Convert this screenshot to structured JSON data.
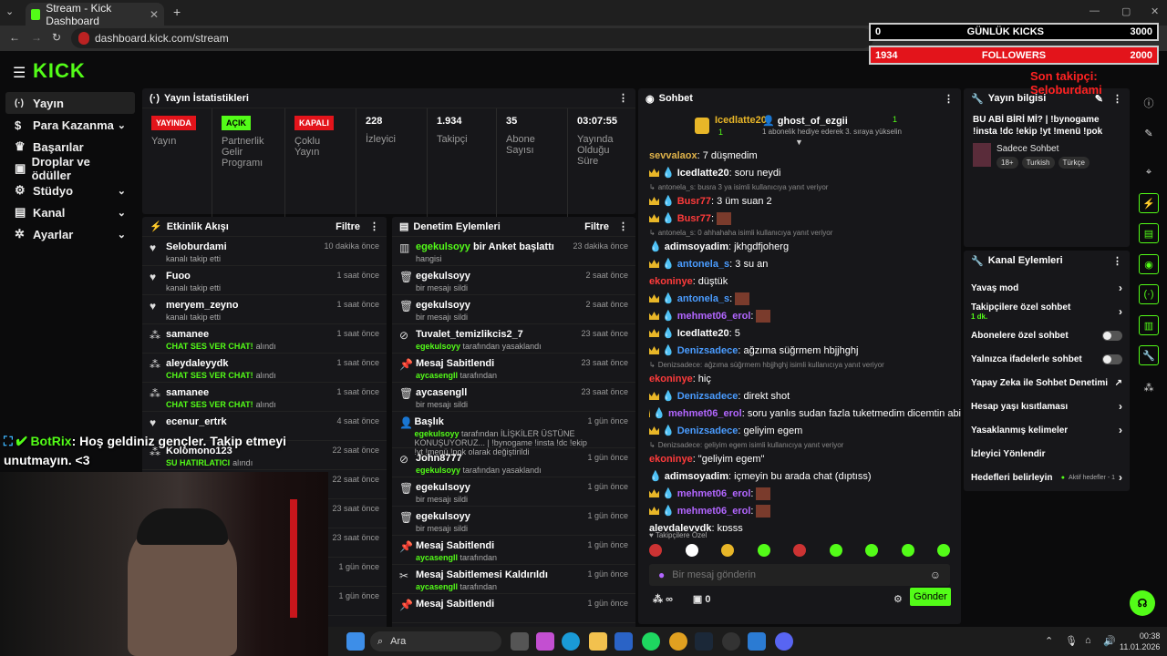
{
  "browser": {
    "tab_title": "Stream - Kick Dashboard",
    "url": "dashboard.kick.com/stream"
  },
  "overlay": {
    "kicks_left": "0",
    "kicks_label": "GÜNLÜK KICKS",
    "kicks_right": "3000",
    "followers_left": "1934",
    "followers_label": "FOLLOWERS",
    "followers_right": "2000",
    "last_follower": "Son takipçi: Seloburdami"
  },
  "logo": "KICK",
  "sidebar": {
    "items": [
      {
        "label": "Yayın"
      },
      {
        "label": "Para Kazanma"
      },
      {
        "label": "Başarılar"
      },
      {
        "label": "Droplar ve ödüller"
      },
      {
        "label": "Stüdyo"
      },
      {
        "label": "Kanal"
      },
      {
        "label": "Ayarlar"
      }
    ]
  },
  "stats": {
    "title": "Yayın İstatistikleri",
    "live_badge": "YAYINDA",
    "live_label": "Yayın",
    "partner_badge": "AÇIK",
    "partner_label": "Partnerlik Gelir Programı",
    "multi_badge": "KAPALI",
    "multi_label": "Çoklu Yayın",
    "viewers": "228",
    "viewers_label": "İzleyici",
    "followers": "1.934",
    "followers_label": "Takipçi",
    "subs": "35",
    "subs_label": "Abone Sayısı",
    "uptime": "03:07:55",
    "uptime_label": "Yayında Olduğu Süre"
  },
  "activity": {
    "title": "Etkinlik Akışı",
    "filter": "Filtre",
    "items": [
      {
        "name": "Seloburdami",
        "sub": "kanalı takip etti",
        "time": "10 dakika önce"
      },
      {
        "name": "Fuoo",
        "sub": "kanalı takip etti",
        "time": "1 saat önce"
      },
      {
        "name": "meryem_zeyno",
        "sub": "kanalı takip etti",
        "time": "1 saat önce"
      },
      {
        "name": "samanee",
        "sub": "CHAT SES VER CHAT!",
        "sub2": "alındı",
        "time": "1 saat önce"
      },
      {
        "name": "aleydaleyydk",
        "sub": "CHAT SES VER CHAT!",
        "sub2": "alındı",
        "time": "1 saat önce"
      },
      {
        "name": "samanee",
        "sub": "CHAT SES VER CHAT!",
        "sub2": "alındı",
        "time": "1 saat önce"
      },
      {
        "name": "ecenur_ertrk",
        "sub": "",
        "time": "4 saat önce"
      },
      {
        "name": "Kolomono123",
        "sub": "SU HATIRLATICI",
        "sub2": "alındı",
        "time": "22 saat önce"
      },
      {
        "time": "22 saat önce"
      },
      {
        "time": "23 saat önce"
      },
      {
        "time": "23 saat önce"
      },
      {
        "time": "1 gün önce"
      },
      {
        "time": "1 gün önce"
      }
    ]
  },
  "mod": {
    "title": "Denetim Eylemleri",
    "filter": "Filtre",
    "items": [
      {
        "icon": "▥",
        "name": "egekulsoyy",
        "name_rest": " bir Anket başlattı",
        "sub": "hangisi",
        "time": "23 dakika önce"
      },
      {
        "icon": "🗑",
        "name": "egekulsoyy",
        "sub": "bir mesajı sildi",
        "time": "2 saat önce"
      },
      {
        "icon": "🗑",
        "name": "egekulsoyy",
        "sub": "bir mesajı sildi",
        "time": "2 saat önce"
      },
      {
        "icon": "⊘",
        "name": "Tuvalet_temizlikcis2_7",
        "subg": "egekulsoyy",
        "sub": " tarafından yasaklandı",
        "time": "23 saat önce"
      },
      {
        "icon": "📌",
        "name": "Mesaj Sabitlendi",
        "subg": "aycasengll",
        "sub": " tarafından",
        "time": "23 saat önce"
      },
      {
        "icon": "🗑",
        "name": "aycasengll",
        "sub": "bir mesajı sildi",
        "time": "23 saat önce"
      },
      {
        "icon": "👤",
        "name": "Başlık",
        "subg": "egekulsoyy",
        "sub": " tarafından İLİŞKİLER ÜSTÜNE KONUŞUYORUZ... | !bynogame !insta !dc !ekip !yt !menü !pok olarak değiştirildi",
        "time": "1 gün önce"
      },
      {
        "icon": "⊘",
        "name": "John8777",
        "subg": "egekulsoyy",
        "sub": " tarafından yasaklandı",
        "time": "1 gün önce"
      },
      {
        "icon": "🗑",
        "name": "egekulsoyy",
        "sub": "bir mesajı sildi",
        "time": "1 gün önce"
      },
      {
        "icon": "🗑",
        "name": "egekulsoyy",
        "sub": "bir mesajı sildi",
        "time": "1 gün önce"
      },
      {
        "icon": "📌",
        "name": "Mesaj Sabitlendi",
        "subg": "aycasengll",
        "sub": " tarafından",
        "time": "1 gün önce"
      },
      {
        "icon": "✂",
        "name": "Mesaj Sabitlemesi Kaldırıldı",
        "subg": "aycasengll",
        "sub": " tarafından",
        "time": "1 gün önce"
      },
      {
        "icon": "📌",
        "name": "Mesaj Sabitlendi",
        "sub": "",
        "time": "1 gün önce"
      }
    ]
  },
  "chat": {
    "title": "Sohbet",
    "top1": "Icedlatte20",
    "top1_count": "1",
    "top2": "ghost_of_ezgii",
    "top2_count": "1",
    "gift_msg": "1 abonelik hediye ederek 3. sıraya yükselin",
    "placeholder": "Bir mesaj gönderin",
    "send": "Gönder",
    "followers_only": "Takipçilere Özel",
    "counter": "0",
    "infinity": "∞",
    "lines": [
      {
        "user": "sevvalaox",
        "ucolor": "#e0b34a",
        "text": ": 7 düşmedim"
      },
      {
        "user": "Icedlatte20",
        "ucolor": "#ffffff",
        "crown": 1,
        "drop": 1,
        "text": ": soru neydi"
      },
      {
        "reply": "antonela_s: busra 3 ya isimli kullanıcıya yanıt veriyor"
      },
      {
        "user": "Busr77",
        "ucolor": "#ff3b3b",
        "crown": 1,
        "drop": 1,
        "text": ": 3 üm suan 2"
      },
      {
        "user": "Busr77",
        "ucolor": "#ff3b3b",
        "crown": 1,
        "drop": 1,
        "text": ":",
        "emote": 1
      },
      {
        "reply": "antonela_s: 0 ahhahaha isimli kullanıcıya yanıt veriyor"
      },
      {
        "user": "adimsoyadim",
        "ucolor": "#ffffff",
        "drop": 1,
        "text": ": jkhgdfjoherg"
      },
      {
        "user": "antonela_s",
        "ucolor": "#4a9cff",
        "crown": 1,
        "drop": 1,
        "text": ": 3 su an"
      },
      {
        "user": "ekoninye",
        "ucolor": "#ff3b3b",
        "text": ": düştük"
      },
      {
        "user": "antonela_s",
        "ucolor": "#4a9cff",
        "crown": 1,
        "drop": 1,
        "text": ":",
        "emote": 1
      },
      {
        "user": "mehmet06_erol",
        "ucolor": "#b266ff",
        "crown": 1,
        "drop": 1,
        "text": ":",
        "emote": 1
      },
      {
        "user": "Icedlatte20",
        "ucolor": "#ffffff",
        "crown": 1,
        "drop": 1,
        "text": ": 5"
      },
      {
        "user": "Denizsadece",
        "ucolor": "#4a9cff",
        "crown": 1,
        "drop": 1,
        "text": ": ağzıma süğrmem hbjjhghj"
      },
      {
        "reply": "Denizsadece: ağzıma süğrmem hbjjhghj isimli kullanıcıya yanıt veriyor"
      },
      {
        "user": "ekoninye",
        "ucolor": "#ff3b3b",
        "text": ": hiç"
      },
      {
        "user": "Denizsadece",
        "ucolor": "#4a9cff",
        "crown": 1,
        "drop": 1,
        "text": ": direkt shot"
      },
      {
        "user": "mehmet06_erol",
        "ucolor": "#b266ff",
        "crown": 1,
        "drop": 1,
        "text": ": soru yanlıs sudan fazla tuketmedim dicemtin abi"
      },
      {
        "user": "Denizsadece",
        "ucolor": "#4a9cff",
        "crown": 1,
        "drop": 1,
        "text": ": geliyim egem"
      },
      {
        "reply": "Denizsadece: geliyim egem isimli kullanıcıya yanıt veriyor"
      },
      {
        "user": "ekoninye",
        "ucolor": "#ff3b3b",
        "text": ": \"geliyim egem\""
      },
      {
        "user": "adimsoyadim",
        "ucolor": "#ffffff",
        "drop": 1,
        "text": ": içmeyin bu arada chat (dıptıss)"
      },
      {
        "user": "mehmet06_erol",
        "ucolor": "#b266ff",
        "crown": 1,
        "drop": 1,
        "text": ":",
        "emote": 1
      },
      {
        "user": "mehmet06_erol",
        "ucolor": "#b266ff",
        "crown": 1,
        "drop": 1,
        "text": ":",
        "emote": 1
      },
      {
        "user": "aleydaleyydk",
        "ucolor": "#ffffff",
        "text": ": kpsss"
      },
      {
        "user": "BotRix",
        "ucolor": "#ffffff",
        "text": ": Hoş geldiniz gençler. Takip etmeyi unutmayın. <3"
      }
    ]
  },
  "info": {
    "title": "Yayın bilgisi",
    "stream_title": "BU ABİ BİRİ Mİ? | !bynogame !insta !dc !ekip !yt !menü !pok",
    "category": "Sadece Sohbet",
    "tags": [
      "18+",
      "Turkish",
      "Türkçe"
    ]
  },
  "kanal": {
    "title": "Kanal Eylemleri",
    "items": [
      {
        "label": "Yavaş mod",
        "kind": "chev"
      },
      {
        "label": "Takipçilere özel sohbet",
        "sub": "1 dk.",
        "kind": "chev"
      },
      {
        "label": "Abonelere özel sohbet",
        "kind": "tog"
      },
      {
        "label": "Yalnızca ifadelerle sohbet",
        "kind": "tog"
      },
      {
        "label": "Yapay Zeka ile Sohbet Denetimi",
        "kind": "ext"
      },
      {
        "label": "Hesap yaşı kısıtlaması",
        "kind": "chev"
      },
      {
        "label": "Yasaklanmış kelimeler",
        "kind": "chev"
      },
      {
        "label": "İzleyici Yönlendir",
        "kind": ""
      },
      {
        "label": "Hedefleri belirleyin",
        "kind": "chev",
        "status": "Aktif hedefler - 1"
      }
    ]
  },
  "botrix_overlay": {
    "user": "BotRix",
    "text": ": Hoş geldiniz gençler. Takip etmeyi unutmayın. <3"
  },
  "taskbar": {
    "search": "Ara",
    "time": "00:38",
    "date": "11.01.2026"
  }
}
